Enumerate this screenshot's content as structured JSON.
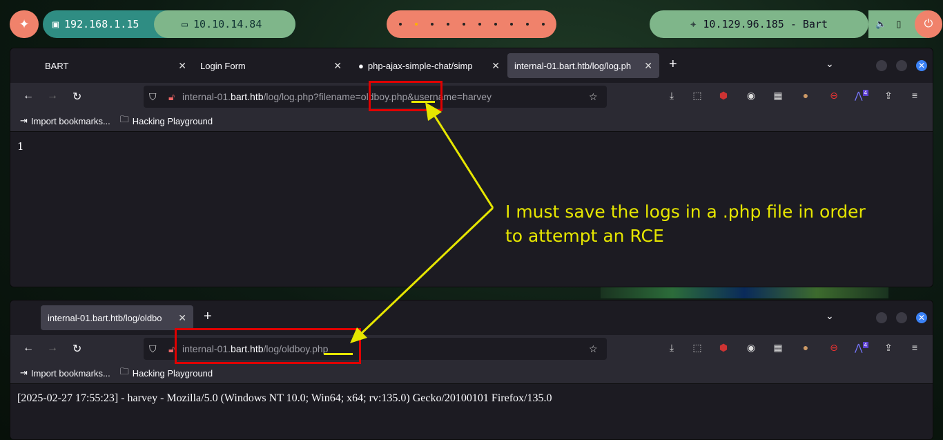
{
  "topbar": {
    "local_ip": "192.168.1.15",
    "vpn_ip": "10.10.14.84",
    "target": "10.129.96.185 - Bart",
    "workspaces": 10,
    "active_workspace": 2
  },
  "window1": {
    "tabs": [
      {
        "label": "BART"
      },
      {
        "label": "Login Form"
      },
      {
        "label": "php-ajax-simple-chat/simp"
      },
      {
        "label": "internal-01.bart.htb/log/log.ph"
      }
    ],
    "url_prefix": "internal-01.",
    "url_host": "bart.htb",
    "url_rest": "/log/log.php?filename=oldboy.php&username=harvey",
    "bookmarks": [
      "Import bookmarks...",
      "Hacking Playground"
    ],
    "content": "1"
  },
  "window2": {
    "tabs": [
      {
        "label": "internal-01.bart.htb/log/oldbo"
      }
    ],
    "url_prefix": "internal-01.",
    "url_host": "bart.htb",
    "url_rest": "/log/oldboy.php",
    "bookmarks": [
      "Import bookmarks...",
      "Hacking Playground"
    ],
    "content": "[2025-02-27 17:55:23] - harvey - Mozilla/5.0 (Windows NT 10.0; Win64; x64; rv:135.0) Gecko/20100101 Firefox/135.0"
  },
  "annotation": {
    "line1": "I must save the logs in a .php file in order",
    "line2": "to attempt an RCE",
    "color": "#e6e600",
    "box_color": "#e00000"
  },
  "extensions": {
    "badge_count": "4"
  }
}
